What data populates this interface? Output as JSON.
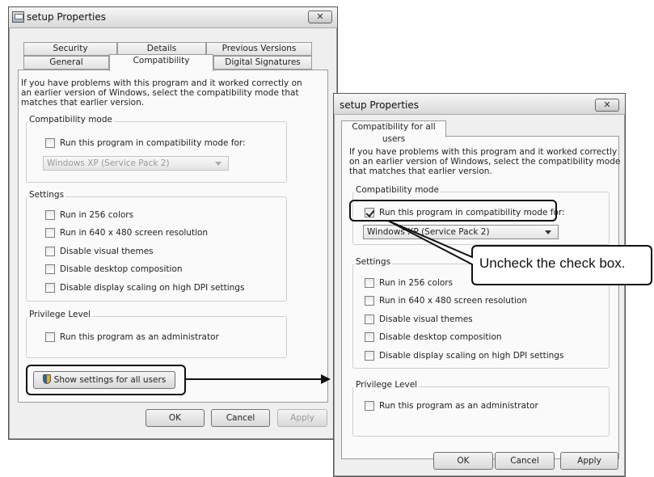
{
  "left_dialog": {
    "title": "setup Properties",
    "close_label": "✕",
    "tabs_row1": [
      "Security",
      "Details",
      "Previous Versions"
    ],
    "tabs_row2": [
      "General",
      "Compatibility",
      "Digital Signatures"
    ],
    "intro_lines": [
      "If you have problems with this program and it worked correctly on",
      "an earlier version of Windows, select the compatibility mode that",
      "matches that earlier version."
    ],
    "compat_group": "Compatibility mode",
    "compat_checkbox": "Run this program in compatibility mode for:",
    "compat_select": "Windows XP (Service Pack 2)",
    "settings_group": "Settings",
    "settings": [
      "Run in 256 colors",
      "Run in 640 x 480 screen resolution",
      "Disable visual themes",
      "Disable desktop composition",
      "Disable display scaling on high DPI settings"
    ],
    "privilege_group": "Privilege Level",
    "privilege_checkbox": "Run this program as an administrator",
    "show_all_users_button": "Show settings for all users",
    "ok": "OK",
    "cancel": "Cancel",
    "apply": "Apply"
  },
  "right_dialog": {
    "title": "setup Properties",
    "close_label": "✕",
    "tab": "Compatibility for all users",
    "intro_lines": [
      "If you have problems with this program and it worked correctly",
      "on an earlier version of Windows, select the compatibility mode",
      "that matches that earlier version."
    ],
    "compat_group": "Compatibility mode",
    "compat_checkbox": "Run this program in compatibility mode for:",
    "compat_checked": true,
    "compat_select": "Windows XP (Service Pack 2)",
    "settings_group": "Settings",
    "settings": [
      "Run in 256 colors",
      "Run in 640 x 480 screen resolution",
      "Disable visual themes",
      "Disable desktop composition",
      "Disable display scaling on high DPI settings"
    ],
    "privilege_group": "Privilege Level",
    "privilege_checkbox": "Run this program as an administrator",
    "ok": "OK",
    "cancel": "Cancel",
    "apply": "Apply"
  },
  "annotation": {
    "callout_text": "Uncheck the check box."
  }
}
